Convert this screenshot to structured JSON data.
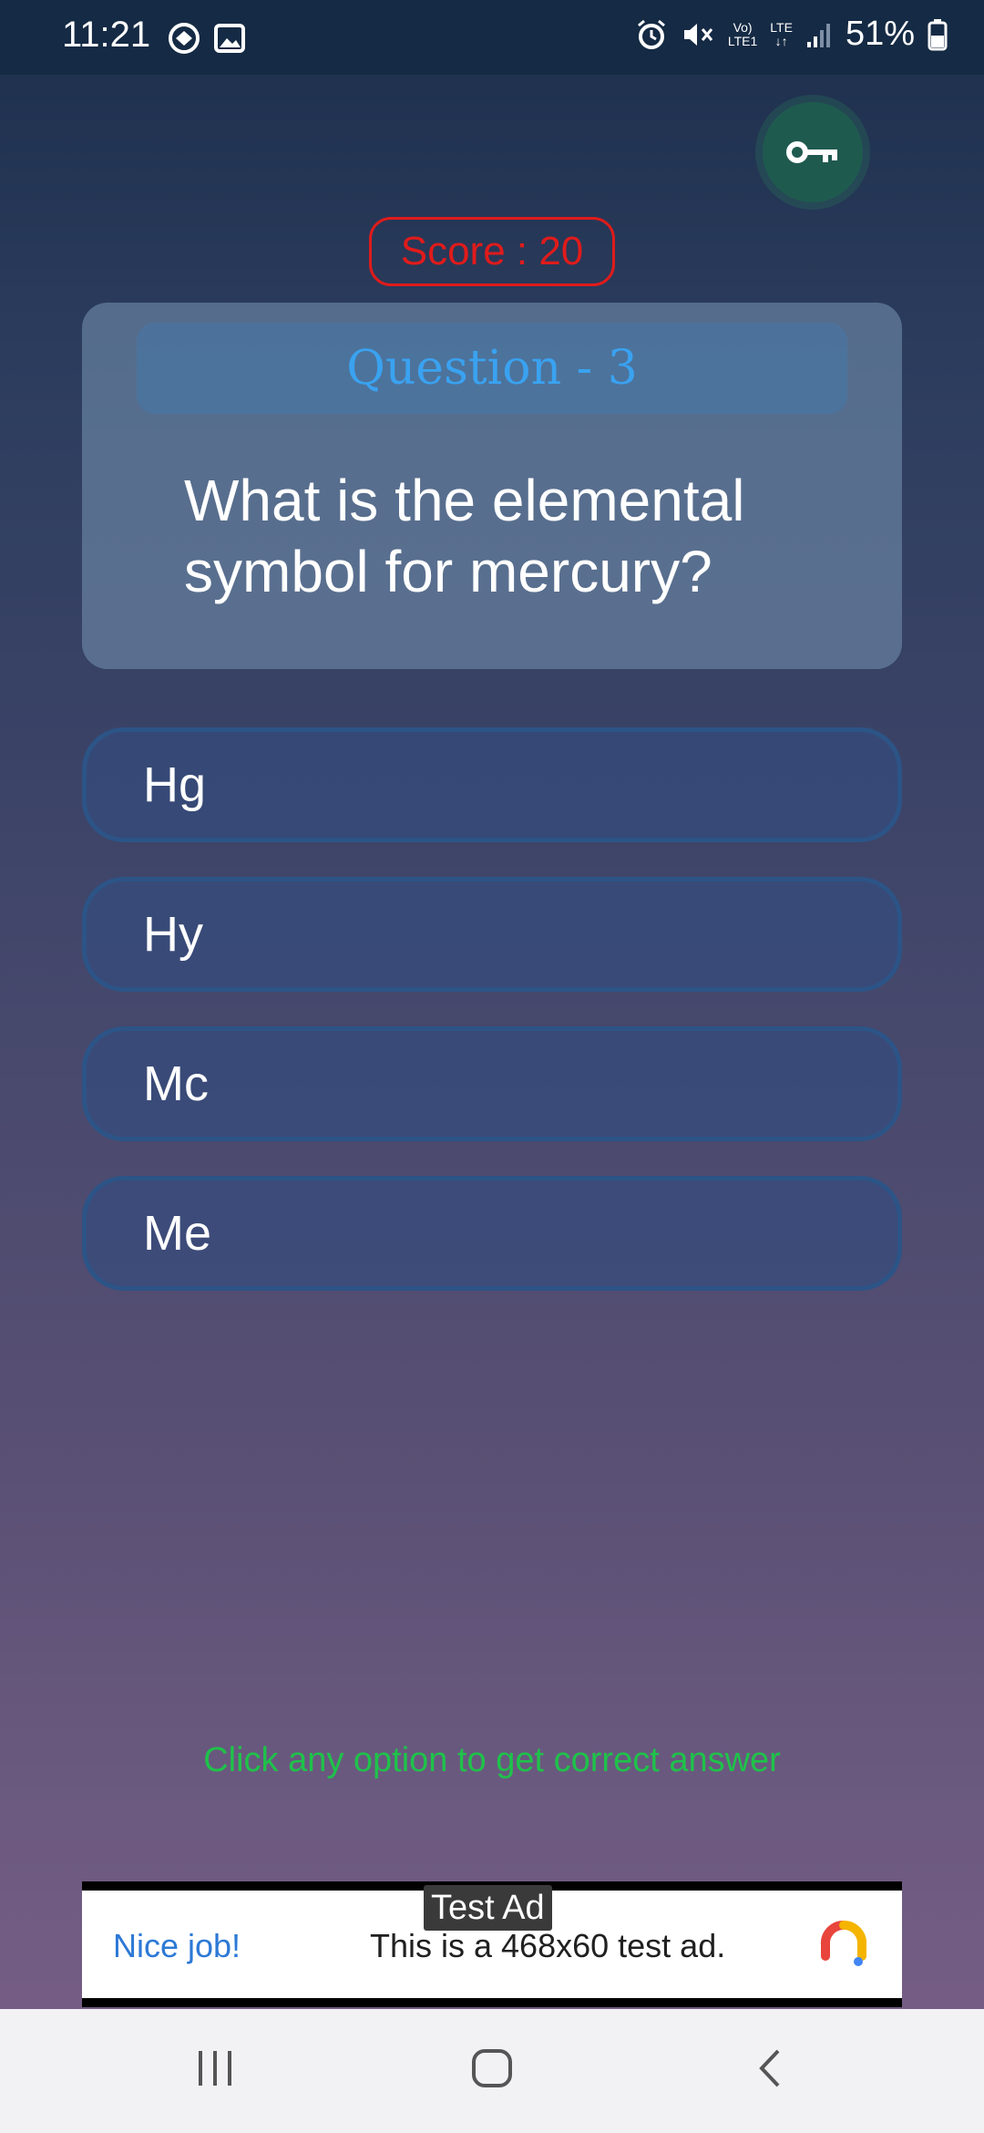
{
  "status_bar": {
    "time": "11:21",
    "network_small_top": "Vo)",
    "network_small_bottom": "LTE1",
    "lte_label_top": "LTE",
    "lte_label_bottom": "↓↑",
    "battery": "51%"
  },
  "quiz": {
    "score_label": "Score : 20",
    "question_number": "Question - 3",
    "question_text": "What is the elemental symbol for mercury?",
    "options": [
      "Hg",
      "Hy",
      "Mc",
      "Me"
    ],
    "hint": "Click any option to get correct answer"
  },
  "ad": {
    "label": "Test Ad",
    "headline": "Nice job!",
    "body": "This is a 468x60 test ad."
  },
  "colors": {
    "score": "#e01b1b",
    "question_number": "#3aa2f0",
    "hint": "#1fc24a",
    "key_button": "#1f5a4f"
  },
  "icons": {
    "key_button": "key-icon",
    "nav": [
      "recent-apps-icon",
      "home-icon",
      "back-icon"
    ]
  }
}
